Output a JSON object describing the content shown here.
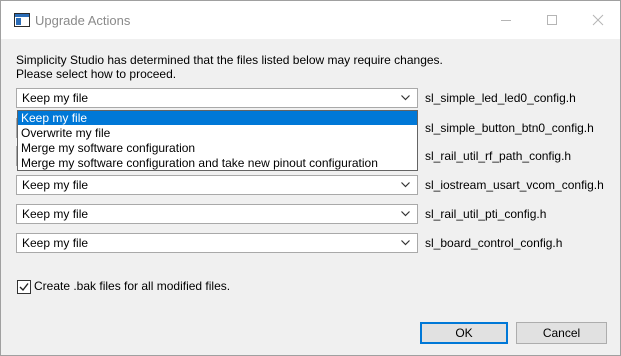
{
  "window": {
    "title": "Upgrade Actions",
    "icons": {
      "app": "app-window-icon",
      "minimize": "minimize-icon",
      "maximize": "maximize-icon",
      "close": "close-icon"
    }
  },
  "message": {
    "line1": "Simplicity Studio has determined that the files listed below may require changes.",
    "line2": "Please select how to proceed."
  },
  "rows": [
    {
      "value": "Keep my file",
      "file": "sl_simple_led_led0_config.h"
    },
    {
      "value": "",
      "file": "sl_simple_button_btn0_config.h"
    },
    {
      "value": "",
      "file": "sl_rail_util_rf_path_config.h"
    },
    {
      "value": "Keep my file",
      "file": "sl_iostream_usart_vcom_config.h"
    },
    {
      "value": "Keep my file",
      "file": "sl_rail_util_pti_config.h"
    },
    {
      "value": "Keep my file",
      "file": "sl_board_control_config.h"
    }
  ],
  "dropdown": {
    "options": [
      "Keep my file",
      "Overwrite my file",
      "Merge my software configuration",
      "Merge my software configuration and take new pinout configuration"
    ],
    "selected_index": 0
  },
  "checkbox": {
    "label": "Create .bak files for all modified files.",
    "checked": true
  },
  "buttons": {
    "ok": "OK",
    "cancel": "Cancel"
  },
  "colors": {
    "selection": "#0078d7",
    "default_button_border": "#0078d7"
  }
}
